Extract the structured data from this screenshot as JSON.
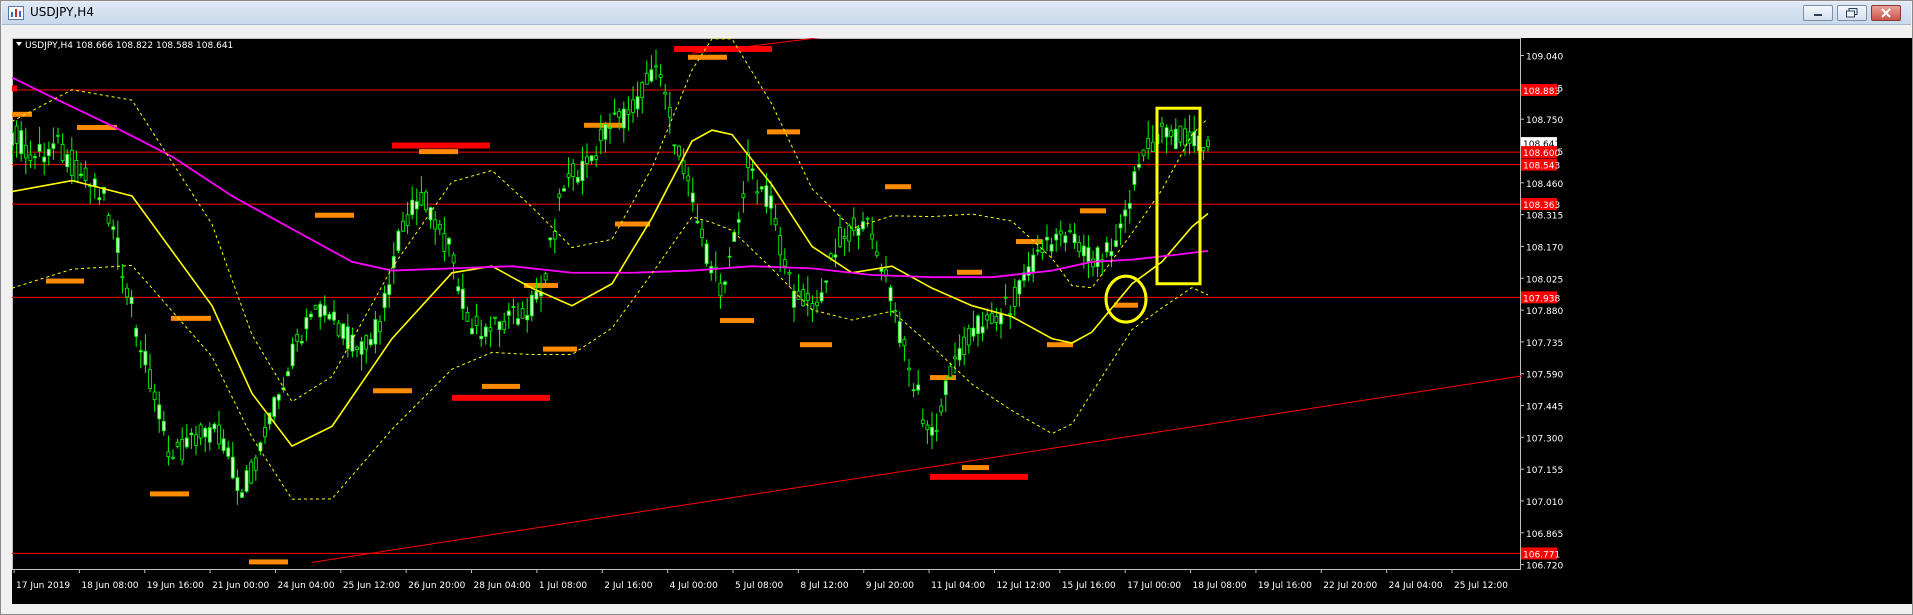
{
  "window": {
    "title": "USDJPY,H4"
  },
  "chart_header": {
    "symbol": "USDJPY,H4",
    "ohlc": "108.666 108.822 108.588 108.641"
  },
  "colors": {
    "background": "#000000",
    "up_candle": "#00ff00",
    "candle_body": "#ccffcc",
    "ma_yellow": "#ffff00",
    "ma_magenta": "#ff00ff",
    "bands": "#ffff00",
    "level_line": "#ff0000",
    "zone_orange": "#ff8c00",
    "zone_red": "#ff0000",
    "annotation": "#ffff00"
  },
  "chart_data": {
    "type": "line",
    "title": "USDJPY,H4",
    "ylim": [
      106.7,
      109.12
    ],
    "y_ticks": [
      109.04,
      108.895,
      108.75,
      108.605,
      108.46,
      108.315,
      108.17,
      108.025,
      107.88,
      107.735,
      107.59,
      107.445,
      107.3,
      107.155,
      107.01,
      106.865,
      106.72
    ],
    "x_labels": [
      "17 Jun 2019",
      "18 Jun 08:00",
      "19 Jun 16:00",
      "21 Jun 00:00",
      "24 Jun 04:00",
      "25 Jun 12:00",
      "26 Jun 20:00",
      "28 Jun 04:00",
      "1 Jul 08:00",
      "2 Jul 16:00",
      "4 Jul 00:00",
      "5 Jul 08:00",
      "8 Jul 12:00",
      "9 Jul 20:00",
      "11 Jul 04:00",
      "12 Jul 12:00",
      "15 Jul 16:00",
      "17 Jul 00:00",
      "18 Jul 08:00",
      "19 Jul 16:00",
      "22 Jul 20:00",
      "24 Jul 04:00",
      "25 Jul 12:00"
    ],
    "price_tags": [
      108.883,
      108.641,
      108.6,
      108.543,
      108.363,
      107.938,
      106.771
    ],
    "horizontal_levels": [
      108.883,
      108.6,
      108.543,
      108.363,
      107.938,
      106.771
    ],
    "series": [
      {
        "name": "",
        "x": [
          0,
          23,
          46,
          69,
          92,
          115,
          138,
          161,
          184,
          207,
          230,
          253,
          276,
          299,
          322,
          345,
          368,
          391,
          414,
          437,
          460,
          483,
          506,
          529,
          552,
          575,
          598,
          621,
          644,
          667,
          690,
          713,
          736,
          759,
          782,
          805,
          828,
          851,
          874,
          897,
          920,
          943,
          966,
          989,
          1012,
          1035,
          1058,
          1081,
          1104,
          1127,
          1150,
          1173,
          1196
        ],
        "y": [
          108.69,
          108.58,
          108.62,
          108.5,
          108.38,
          108.0,
          107.55,
          107.2,
          107.3,
          107.32,
          107.05,
          107.3,
          107.62,
          107.9,
          107.85,
          107.7,
          107.8,
          108.3,
          108.38,
          108.15,
          107.8,
          107.8,
          107.85,
          107.95,
          108.45,
          108.55,
          108.72,
          108.8,
          109.0,
          108.6,
          108.2,
          107.95,
          108.55,
          108.35,
          107.95,
          107.9,
          108.2,
          108.3,
          108.05,
          107.6,
          107.3,
          107.65,
          107.8,
          107.85,
          108.0,
          108.2,
          108.2,
          108.1,
          108.15,
          108.55,
          108.7,
          108.65,
          108.64
        ]
      },
      {
        "name": "",
        "x": [
          0,
          60,
          120,
          200,
          240,
          280,
          320,
          380,
          440,
          480,
          520,
          560,
          600,
          640,
          680,
          700,
          720,
          760,
          800,
          840,
          880,
          920,
          960,
          1000,
          1040,
          1060,
          1080,
          1120,
          1150,
          1180,
          1196
        ],
        "y": [
          108.42,
          108.47,
          108.4,
          107.9,
          107.5,
          107.26,
          107.35,
          107.75,
          108.05,
          108.08,
          107.98,
          107.9,
          108.0,
          108.3,
          108.65,
          108.7,
          108.68,
          108.45,
          108.17,
          108.05,
          108.08,
          107.98,
          107.9,
          107.85,
          107.75,
          107.73,
          107.78,
          108.0,
          108.1,
          108.26,
          108.32
        ]
      },
      {
        "name": "",
        "x": [
          0,
          40,
          100,
          160,
          220,
          300,
          340,
          380,
          440,
          500,
          560,
          620,
          680,
          740,
          800,
          860,
          920,
          980,
          1040,
          1080,
          1120,
          1160,
          1196
        ],
        "y": [
          108.94,
          108.85,
          108.72,
          108.58,
          108.4,
          108.2,
          108.1,
          108.06,
          108.07,
          108.08,
          108.05,
          108.05,
          108.06,
          108.08,
          108.07,
          108.04,
          108.03,
          108.03,
          108.06,
          108.1,
          108.11,
          108.13,
          108.15
        ]
      }
    ],
    "zones": [
      {
        "color": "#ff0000",
        "x": [
          -5,
          5
        ],
        "y": 108.89
      },
      {
        "color": "#ff8c00",
        "x": [
          -5,
          20
        ],
        "y": 108.77
      },
      {
        "color": "#ff8c00",
        "x": [
          65,
          105
        ],
        "y": 108.71
      },
      {
        "color": "#ff8c00",
        "x": [
          34,
          72
        ],
        "y": 108.01
      },
      {
        "color": "#ff8c00",
        "x": [
          159,
          199
        ],
        "y": 107.84
      },
      {
        "color": "#ff8c00",
        "x": [
          138,
          177
        ],
        "y": 107.04
      },
      {
        "color": "#ff8c00",
        "x": [
          237,
          276
        ],
        "y": 106.73
      },
      {
        "color": "#ff8c00",
        "x": [
          303,
          342
        ],
        "y": 108.31
      },
      {
        "color": "#ff8c00",
        "x": [
          361,
          400
        ],
        "y": 107.51
      },
      {
        "color": "#ff0000",
        "x": [
          380,
          478
        ],
        "y": 108.63
      },
      {
        "color": "#ff8c00",
        "x": [
          407,
          446
        ],
        "y": 108.6
      },
      {
        "color": "#ff0000",
        "x": [
          440,
          538
        ],
        "y": 107.48
      },
      {
        "color": "#ff8c00",
        "x": [
          470,
          508
        ],
        "y": 107.53
      },
      {
        "color": "#ff8c00",
        "x": [
          512,
          546
        ],
        "y": 107.99
      },
      {
        "color": "#ff8c00",
        "x": [
          531,
          565
        ],
        "y": 107.7
      },
      {
        "color": "#ff8c00",
        "x": [
          572,
          610
        ],
        "y": 108.72
      },
      {
        "color": "#ff8c00",
        "x": [
          603,
          638
        ],
        "y": 108.27
      },
      {
        "color": "#ff0000",
        "x": [
          662,
          760
        ],
        "y": 109.07
      },
      {
        "color": "#ff8c00",
        "x": [
          676,
          715
        ],
        "y": 109.03
      },
      {
        "color": "#ff8c00",
        "x": [
          708,
          742
        ],
        "y": 107.83
      },
      {
        "color": "#ff8c00",
        "x": [
          755,
          788
        ],
        "y": 108.69
      },
      {
        "color": "#ff8c00",
        "x": [
          788,
          820
        ],
        "y": 107.72
      },
      {
        "color": "#ff8c00",
        "x": [
          873,
          899
        ],
        "y": 108.44
      },
      {
        "color": "#ff8c00",
        "x": [
          918,
          944
        ],
        "y": 107.57
      },
      {
        "color": "#ff0000",
        "x": [
          918,
          1016
        ],
        "y": 107.12
      },
      {
        "color": "#ff8c00",
        "x": [
          945,
          970
        ],
        "y": 108.05
      },
      {
        "color": "#ff8c00",
        "x": [
          950,
          977
        ],
        "y": 107.16
      },
      {
        "color": "#ff8c00",
        "x": [
          1004,
          1030
        ],
        "y": 108.19
      },
      {
        "color": "#ff8c00",
        "x": [
          1035,
          1061
        ],
        "y": 107.72
      },
      {
        "color": "#ff8c00",
        "x": [
          1068,
          1094
        ],
        "y": 108.33
      },
      {
        "color": "#ff8c00",
        "x": [
          1102,
          1126
        ],
        "y": 107.9
      }
    ],
    "trendlines": [
      {
        "x": [
          300,
          1510
        ],
        "y": [
          106.73,
          107.58
        ]
      },
      {
        "x": [
          680,
          840
        ],
        "y": [
          109.05,
          109.14
        ]
      }
    ],
    "annotations": [
      {
        "shape": "ellipse",
        "x": 1114,
        "y": 107.93
      },
      {
        "shape": "rect",
        "x": [
          1145,
          1188
        ],
        "y": [
          108.0,
          108.8
        ]
      }
    ]
  }
}
